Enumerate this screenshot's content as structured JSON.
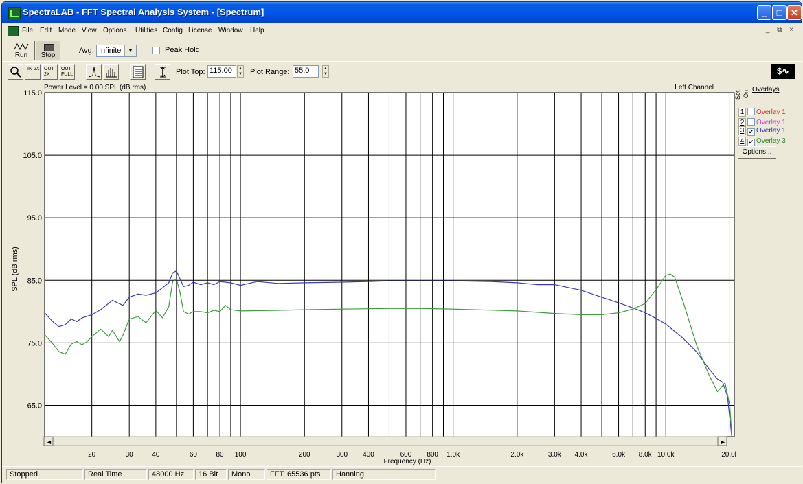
{
  "window": {
    "title": "SpectraLAB - FFT Spectral Analysis System - [Spectrum]",
    "controls": {
      "minimize": "_",
      "maximize": "□",
      "close": "✕"
    }
  },
  "menu": {
    "items": [
      "File",
      "Edit",
      "Mode",
      "View",
      "Options",
      "Utilities",
      "Config",
      "License",
      "Window",
      "Help"
    ],
    "mdi_controls": "_ ⧉ ×"
  },
  "toolbar": {
    "run_label": "Run",
    "stop_label": "Stop",
    "avg_label": "Avg:",
    "avg_value": "Infinite",
    "peak_hold_label": "Peak Hold",
    "peak_hold_checked": false,
    "zoom_in_label": "IN 2X",
    "zoom_out_label": "OUT 2X",
    "zoom_full_label": "OUT FULL",
    "plot_top_label": "Plot Top:",
    "plot_top_value": "115.00",
    "plot_range_label": "Plot Range:",
    "plot_range_value": "55.0"
  },
  "colors": {
    "accent": "#0a5de3",
    "series_blue": "#3a3ab8",
    "series_green": "#3e9a3e",
    "overlay1_red": "#e03030",
    "overlay1_magenta": "#d040d0",
    "overlay3_blue": "#3030b0",
    "overlay4_green": "#2a8a2a"
  },
  "chart_data": {
    "type": "line",
    "header_left": "Power Level = 0.00 SPL (dB rms)",
    "header_right": "Left Channel",
    "xlabel": "Frequency (Hz)",
    "ylabel": "SPL (dB rms)",
    "x_scale": "log",
    "xlim": [
      12,
      21000
    ],
    "ylim": [
      60,
      115
    ],
    "grid": true,
    "y_ticks": [
      115,
      105,
      95,
      85,
      75,
      65
    ],
    "y_tick_labels": [
      "115.0",
      "105.0",
      "95.0",
      "85.0",
      "75.0",
      "65.0"
    ],
    "x_ticks": [
      20,
      30,
      40,
      60,
      80,
      100,
      200,
      300,
      400,
      600,
      800,
      1000,
      2000,
      3000,
      4000,
      6000,
      8000,
      10000,
      20000
    ],
    "x_tick_labels": [
      "20",
      "30",
      "40",
      "60",
      "80",
      "100",
      "200",
      "300",
      "400",
      "600",
      "800",
      "1.0k",
      "2.0k",
      "3.0k",
      "4.0k",
      "6.0k",
      "8.0k",
      "10.0k",
      "20.0k"
    ],
    "grid_x": [
      20,
      30,
      40,
      50,
      60,
      70,
      80,
      90,
      100,
      200,
      300,
      400,
      500,
      600,
      700,
      800,
      900,
      1000,
      2000,
      3000,
      4000,
      5000,
      6000,
      7000,
      8000,
      9000,
      10000,
      20000
    ],
    "series": [
      {
        "color": "#3a3ab8",
        "x": [
          12,
          13,
          14,
          15,
          16,
          17,
          18,
          20,
          22,
          25,
          28,
          30,
          33,
          36,
          40,
          43,
          46,
          48,
          50,
          52,
          54,
          57,
          60,
          65,
          70,
          75,
          80,
          90,
          100,
          120,
          150,
          200,
          300,
          400,
          500,
          700,
          1000,
          1500,
          2000,
          2500,
          3000,
          4000,
          5000,
          6000,
          7000,
          8000,
          9000,
          10000,
          12000,
          14000,
          16000,
          17500,
          18500,
          19500,
          20500
        ],
        "y": [
          79.8,
          78.5,
          77.6,
          77.9,
          78.8,
          78.4,
          79.0,
          79.5,
          80.3,
          81.8,
          81.0,
          82.3,
          82.8,
          82.6,
          83.0,
          83.8,
          84.6,
          86.2,
          86.5,
          85.2,
          84.0,
          84.2,
          84.7,
          84.3,
          84.6,
          84.3,
          84.8,
          84.6,
          84.2,
          84.8,
          84.5,
          84.6,
          84.7,
          84.8,
          84.9,
          84.9,
          84.9,
          84.8,
          84.6,
          84.3,
          84.3,
          83.4,
          82.3,
          81.4,
          80.6,
          79.8,
          78.9,
          78.0,
          75.8,
          73.5,
          70.8,
          69.2,
          68.7,
          66.5,
          59.5
        ]
      },
      {
        "color": "#3e9a3e",
        "x": [
          12,
          13,
          14,
          15,
          16,
          17,
          18,
          19,
          20,
          22,
          24,
          25,
          27,
          28,
          30,
          33,
          36,
          40,
          43,
          46,
          48,
          50,
          52,
          54,
          57,
          60,
          65,
          70,
          75,
          80,
          85,
          90,
          100,
          150,
          200,
          300,
          500,
          700,
          1000,
          2000,
          3000,
          4000,
          5000,
          6000,
          7000,
          8000,
          9000,
          10000,
          10500,
          11000,
          12000,
          14000,
          16000,
          17500,
          19000,
          20000,
          20500
        ],
        "y": [
          76.3,
          75.0,
          73.6,
          73.2,
          74.8,
          75.2,
          74.7,
          75.2,
          76.0,
          77.2,
          76.0,
          77.0,
          75.2,
          76.2,
          78.8,
          79.2,
          78.2,
          80.2,
          79.0,
          80.8,
          84.8,
          85.2,
          83.0,
          80.0,
          79.6,
          80.0,
          80.0,
          79.8,
          80.2,
          80.0,
          81.0,
          80.3,
          80.1,
          80.2,
          80.3,
          80.4,
          80.5,
          80.5,
          80.4,
          80.1,
          79.7,
          79.5,
          79.5,
          79.8,
          80.4,
          81.3,
          83.5,
          85.8,
          86.0,
          85.5,
          81.8,
          74.5,
          69.8,
          67.2,
          68.6,
          65.0,
          59.5
        ]
      }
    ]
  },
  "overlays": {
    "title": "Overlays",
    "header_set": "Set",
    "header_on": "On",
    "items": [
      {
        "num": "1",
        "checked": false,
        "label": "Overlay 1",
        "color": "#e03030"
      },
      {
        "num": "2",
        "checked": false,
        "label": "Overlay 1",
        "color": "#d040d0"
      },
      {
        "num": "3",
        "checked": true,
        "label": "Overlay 1",
        "color": "#3030b0"
      },
      {
        "num": "4",
        "checked": true,
        "label": "Overlay 3",
        "color": "#2a8a2a"
      }
    ],
    "options_label": "Options..."
  },
  "status": {
    "state": "Stopped",
    "mode": "Real Time",
    "sample_rate": "48000 Hz",
    "bits": "16 Bit",
    "channels": "Mono",
    "fft": "FFT: 65536 pts",
    "window": "Hanning"
  }
}
